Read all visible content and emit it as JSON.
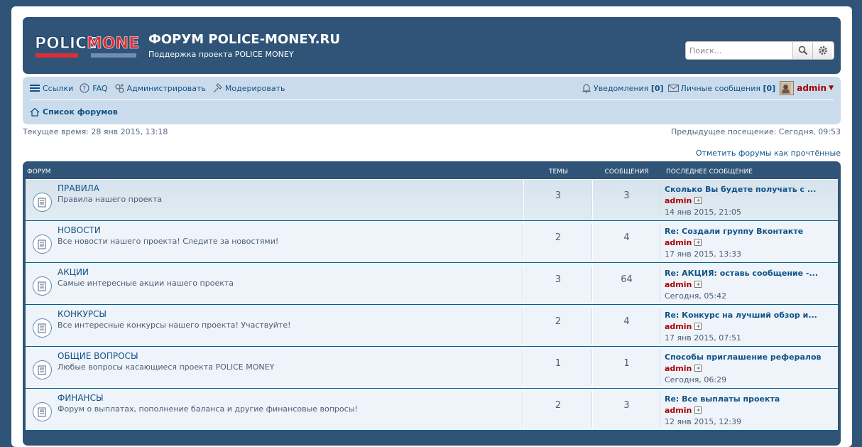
{
  "header": {
    "logo_text_1": "POLICE",
    "logo_text_2": "MONEY",
    "site_title": "ФОРУМ POLICE-MONEY.RU",
    "site_description": "Поддержка проекта POLICE MONEY",
    "search_placeholder": "Поиск..."
  },
  "nav": {
    "left": [
      {
        "label": "Ссылки",
        "icon": "menu-icon"
      },
      {
        "label": "FAQ",
        "icon": "help-icon"
      },
      {
        "label": "Администрировать",
        "icon": "admin-icon"
      },
      {
        "label": "Модерировать",
        "icon": "moderate-icon"
      }
    ],
    "notifications_label": "Уведомления",
    "notifications_count": "[0]",
    "messages_label": "Личные сообщения",
    "messages_count": "[0]",
    "username": "admin",
    "breadcrumb": "Список форумов"
  },
  "info": {
    "current_time": "Текущее время: 28 янв 2015, 13:18",
    "last_visit": "Предыдущее посещение: Сегодня, 09:53",
    "mark_read": "Отметить форумы как прочтённые"
  },
  "table": {
    "headers": {
      "forum": "ФОРУМ",
      "topics": "ТЕМЫ",
      "posts": "СООБЩЕНИЯ",
      "last_post": "ПОСЛЕДНЕЕ СООБЩЕНИЕ"
    },
    "rows": [
      {
        "title": "ПРАВИЛА",
        "desc": "Правила нашего проекта",
        "topics": "3",
        "posts": "3",
        "last_title": "Сколько Вы будете получать с ...",
        "last_user": "admin",
        "last_time": "14 янв 2015, 21:05"
      },
      {
        "title": "НОВОСТИ",
        "desc": "Все новости нашего проекта! Следите за новостями!",
        "topics": "2",
        "posts": "4",
        "last_title": "Re: Создали группу Вконтакте",
        "last_user": "admin",
        "last_time": "17 янв 2015, 13:33"
      },
      {
        "title": "АКЦИИ",
        "desc": "Самые интересные акции нашего проекта",
        "topics": "3",
        "posts": "64",
        "last_title": "Re: АКЦИЯ: оставь сообщение -...",
        "last_user": "admin",
        "last_time": "Сегодня, 05:42"
      },
      {
        "title": "КОНКУРСЫ",
        "desc": "Все интересные конкурсы нашего проекта! Участвуйте!",
        "topics": "2",
        "posts": "4",
        "last_title": "Re: Конкурс на лучший обзор и...",
        "last_user": "admin",
        "last_time": "17 янв 2015, 07:51"
      },
      {
        "title": "ОБЩИЕ ВОПРОСЫ",
        "desc": "Любые вопросы касающиеся проекта POLICE MONEY",
        "topics": "1",
        "posts": "1",
        "last_title": "Способы приглашение рефералов",
        "last_user": "admin",
        "last_time": "Сегодня, 06:29"
      },
      {
        "title": "ФИНАНСЫ",
        "desc": "Форум о выплатах, пополнение баланса и другие финансовые вопросы!",
        "topics": "2",
        "posts": "3",
        "last_title": "Re: Все выплаты проекта",
        "last_user": "admin",
        "last_time": "12 янв 2015, 12:39"
      }
    ]
  }
}
